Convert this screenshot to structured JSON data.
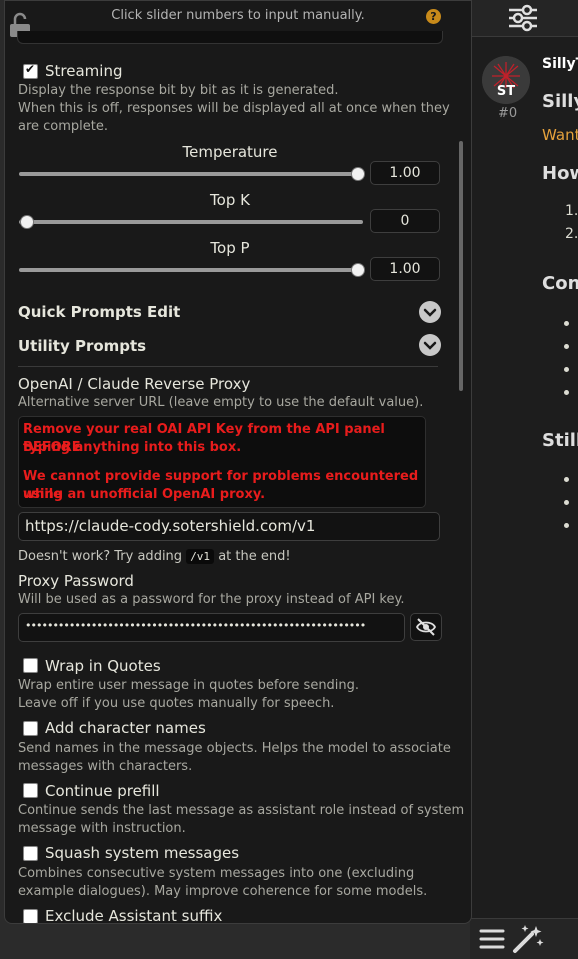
{
  "header": {
    "hint": "Click slider numbers to input manually."
  },
  "streaming": {
    "label": "Streaming",
    "checked": true,
    "desc_1": "Display the response bit by bit as it is generated.",
    "desc_2": "When this is off, responses will be displayed all at once when they",
    "desc_3": "are complete."
  },
  "sliders": {
    "temperature": {
      "label": "Temperature",
      "value": "1.00",
      "level": 1.0
    },
    "top_k": {
      "label": "Top K",
      "value": "0",
      "level": 0.0
    },
    "top_p": {
      "label": "Top P",
      "value": "1.00",
      "level": 1.0
    }
  },
  "sections": {
    "quick_prompts": "Quick Prompts Edit",
    "utility_prompts": "Utility Prompts"
  },
  "proxy": {
    "title": "OpenAI / Claude Reverse Proxy",
    "desc": "Alternative server URL (leave empty to use the default value).",
    "warning_1a": "Remove your real OAI API Key from the API panel BEFORE",
    "warning_1b": "typing anything into this box.",
    "warning_2a": "We cannot provide support for problems encountered while",
    "warning_2b": "using an unofficial OpenAI proxy.",
    "url_value": "https://claude-cody.sotershield.com/v1",
    "hint_before": "Doesn't work? Try adding",
    "hint_code": "/v1",
    "hint_after": "at the end!"
  },
  "password": {
    "title": "Proxy Password",
    "desc": "Will be used as a password for the proxy instead of API key.",
    "masked": "••••••••••••••••••••••••••••••••••••••••••••••••••••••••••••••"
  },
  "options": [
    {
      "label": "Wrap in Quotes",
      "desc_1": "Wrap entire user message in quotes before sending.",
      "desc_2": "Leave off if you use quotes manually for speech."
    },
    {
      "label": "Add character names",
      "desc_1": "Send names in the message objects. Helps the model to associate",
      "desc_2": "messages with characters."
    },
    {
      "label": "Continue prefill",
      "desc_1": "Continue sends the last message as assistant role instead of system",
      "desc_2": "message with instruction."
    },
    {
      "label": "Squash system messages",
      "desc_1": "Combines consecutive system messages into one (excluding",
      "desc_2": "example dialogues). May improve coherence for some models."
    },
    {
      "label": "Exclude Assistant suffix"
    }
  ],
  "chat": {
    "name": "SillyT",
    "heading": "Silly",
    "orange": "Want",
    "how": "How",
    "conf": "Conf",
    "still": "Still",
    "num_1": "1.",
    "num_2": "2.",
    "msg_id": "#0",
    "avatar_text": "ST"
  },
  "colors": {
    "warning": "#e81c1c",
    "accent_orange": "#e6a23c",
    "help_badge": "#c88a1a"
  }
}
